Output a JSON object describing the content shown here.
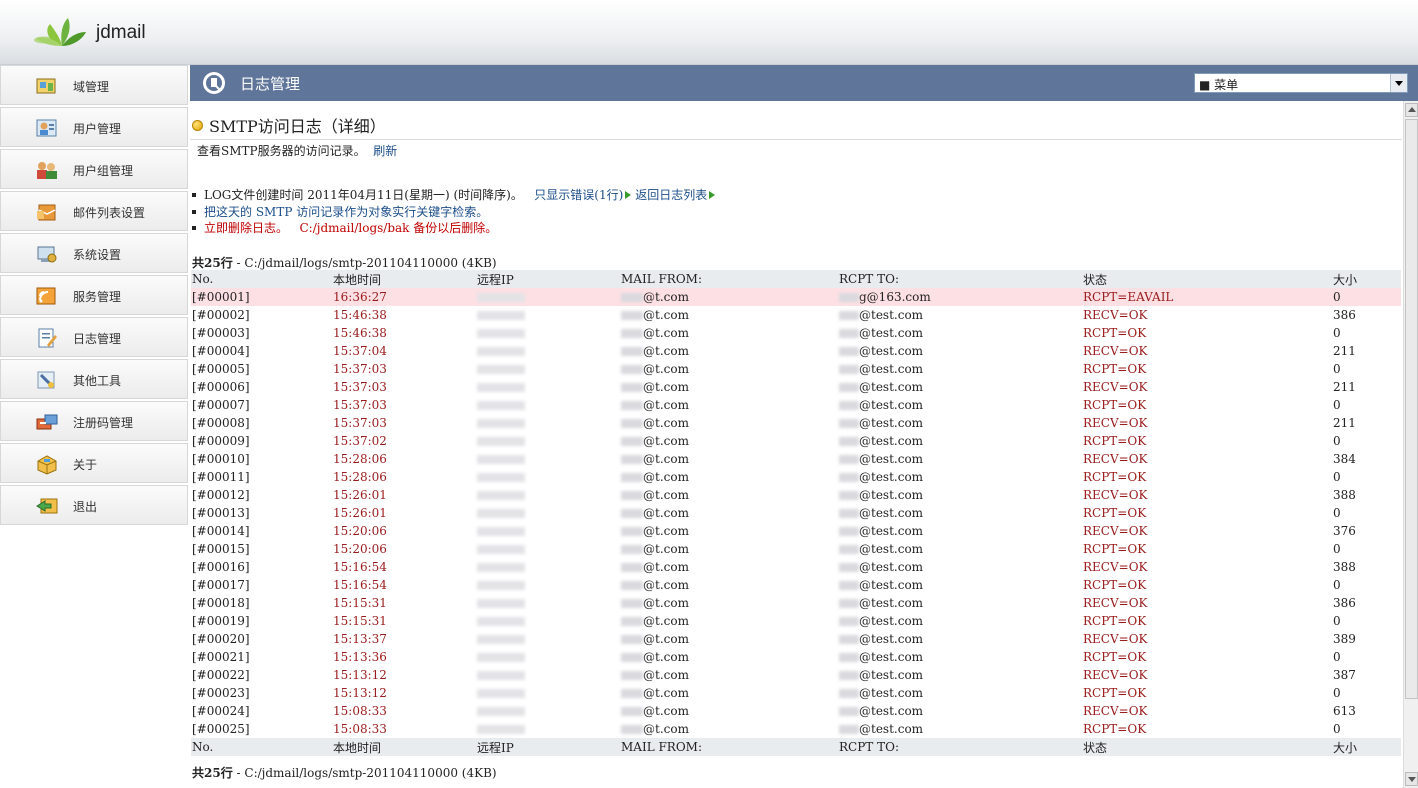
{
  "app": {
    "brand": "jdmail"
  },
  "sidebar": {
    "items": [
      {
        "label": "域管理",
        "icon": "domain-icon"
      },
      {
        "label": "用户管理",
        "icon": "user-icon"
      },
      {
        "label": "用户组管理",
        "icon": "user-group-icon"
      },
      {
        "label": "邮件列表设置",
        "icon": "mail-list-icon"
      },
      {
        "label": "系统设置",
        "icon": "system-settings-icon"
      },
      {
        "label": "服务管理",
        "icon": "service-icon"
      },
      {
        "label": "日志管理",
        "icon": "log-icon"
      },
      {
        "label": "其他工具",
        "icon": "tools-icon"
      },
      {
        "label": "注册码管理",
        "icon": "license-icon"
      },
      {
        "label": "关于",
        "icon": "about-icon"
      },
      {
        "label": "退出",
        "icon": "logout-icon"
      }
    ]
  },
  "header": {
    "title": "日志管理",
    "menu_value": "■ 菜单"
  },
  "page": {
    "title": "SMTP访问日志（详细）",
    "desc": "查看SMTP服务器的访问记录。",
    "refresh": "刷新",
    "b1_text": "LOG文件创建时间 2011年04月11日(星期一) (时间降序)。",
    "b1_link1": "只显示错误(1行)",
    "b1_link2": "返回日志列表",
    "b2_link": "把这天的 SMTP 访问记录作为对象实行关键字检索。",
    "b3_delete": "立即删除日志。",
    "b3_note": "C:/jdmail/logs/bak 备份以后删除。",
    "count_label": "共25行",
    "count_path": " - C:/jdmail/logs/smtp-201104110000 (4KB)"
  },
  "table": {
    "headers": [
      "No.",
      "本地时间",
      "远程IP",
      "MAIL FROM:",
      "RCPT TO:",
      "状态",
      "大小"
    ],
    "rows": [
      {
        "no": "[#00001]",
        "time": "16:36:27",
        "from": "@t.com",
        "to": "g@163.com",
        "status": "RCPT=EAVAIL",
        "size": "0"
      },
      {
        "no": "[#00002]",
        "time": "15:46:38",
        "from": "@t.com",
        "to": "@test.com",
        "status": "RECV=OK",
        "size": "386"
      },
      {
        "no": "[#00003]",
        "time": "15:46:38",
        "from": "@t.com",
        "to": "@test.com",
        "status": "RCPT=OK",
        "size": "0"
      },
      {
        "no": "[#00004]",
        "time": "15:37:04",
        "from": "@t.com",
        "to": "@test.com",
        "status": "RECV=OK",
        "size": "211"
      },
      {
        "no": "[#00005]",
        "time": "15:37:03",
        "from": "@t.com",
        "to": "@test.com",
        "status": "RCPT=OK",
        "size": "0"
      },
      {
        "no": "[#00006]",
        "time": "15:37:03",
        "from": "@t.com",
        "to": "@test.com",
        "status": "RECV=OK",
        "size": "211"
      },
      {
        "no": "[#00007]",
        "time": "15:37:03",
        "from": "@t.com",
        "to": "@test.com",
        "status": "RCPT=OK",
        "size": "0"
      },
      {
        "no": "[#00008]",
        "time": "15:37:03",
        "from": "@t.com",
        "to": "@test.com",
        "status": "RECV=OK",
        "size": "211"
      },
      {
        "no": "[#00009]",
        "time": "15:37:02",
        "from": "@t.com",
        "to": "@test.com",
        "status": "RCPT=OK",
        "size": "0"
      },
      {
        "no": "[#00010]",
        "time": "15:28:06",
        "from": "@t.com",
        "to": "@test.com",
        "status": "RECV=OK",
        "size": "384"
      },
      {
        "no": "[#00011]",
        "time": "15:28:06",
        "from": "@t.com",
        "to": "@test.com",
        "status": "RCPT=OK",
        "size": "0"
      },
      {
        "no": "[#00012]",
        "time": "15:26:01",
        "from": "@t.com",
        "to": "@test.com",
        "status": "RECV=OK",
        "size": "388"
      },
      {
        "no": "[#00013]",
        "time": "15:26:01",
        "from": "@t.com",
        "to": "@test.com",
        "status": "RCPT=OK",
        "size": "0"
      },
      {
        "no": "[#00014]",
        "time": "15:20:06",
        "from": "@t.com",
        "to": "@test.com",
        "status": "RECV=OK",
        "size": "376"
      },
      {
        "no": "[#00015]",
        "time": "15:20:06",
        "from": "@t.com",
        "to": "@test.com",
        "status": "RCPT=OK",
        "size": "0"
      },
      {
        "no": "[#00016]",
        "time": "15:16:54",
        "from": "@t.com",
        "to": "@test.com",
        "status": "RECV=OK",
        "size": "388"
      },
      {
        "no": "[#00017]",
        "time": "15:16:54",
        "from": "@t.com",
        "to": "@test.com",
        "status": "RCPT=OK",
        "size": "0"
      },
      {
        "no": "[#00018]",
        "time": "15:15:31",
        "from": "@t.com",
        "to": "@test.com",
        "status": "RECV=OK",
        "size": "386"
      },
      {
        "no": "[#00019]",
        "time": "15:15:31",
        "from": "@t.com",
        "to": "@test.com",
        "status": "RCPT=OK",
        "size": "0"
      },
      {
        "no": "[#00020]",
        "time": "15:13:37",
        "from": "@t.com",
        "to": "@test.com",
        "status": "RECV=OK",
        "size": "389"
      },
      {
        "no": "[#00021]",
        "time": "15:13:36",
        "from": "@t.com",
        "to": "@test.com",
        "status": "RCPT=OK",
        "size": "0"
      },
      {
        "no": "[#00022]",
        "time": "15:13:12",
        "from": "@t.com",
        "to": "@test.com",
        "status": "RECV=OK",
        "size": "387"
      },
      {
        "no": "[#00023]",
        "time": "15:13:12",
        "from": "@t.com",
        "to": "@test.com",
        "status": "RCPT=OK",
        "size": "0"
      },
      {
        "no": "[#00024]",
        "time": "15:08:33",
        "from": "@t.com",
        "to": "@test.com",
        "status": "RECV=OK",
        "size": "613"
      },
      {
        "no": "[#00025]",
        "time": "15:08:33",
        "from": "@t.com",
        "to": "@test.com",
        "status": "RCPT=OK",
        "size": "0"
      }
    ]
  }
}
